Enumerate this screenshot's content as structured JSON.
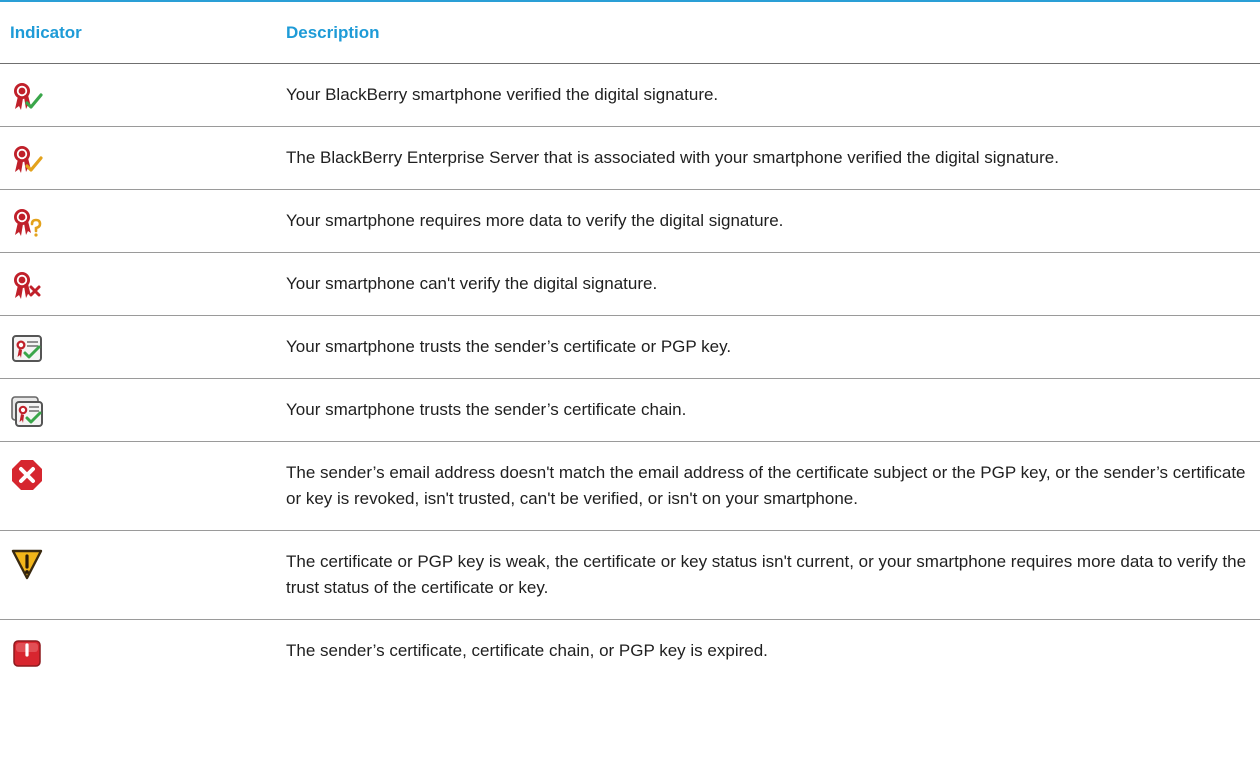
{
  "table": {
    "headers": {
      "indicator": "Indicator",
      "description": "Description"
    },
    "rows": [
      {
        "icon": "seal-check-green-icon",
        "description": "Your BlackBerry smartphone verified the digital signature."
      },
      {
        "icon": "seal-check-orange-icon",
        "description": "The BlackBerry Enterprise Server that is associated with your smartphone verified the digital signature."
      },
      {
        "icon": "seal-question-icon",
        "description": "Your smartphone requires more data to verify the digital signature."
      },
      {
        "icon": "seal-x-icon",
        "description": "Your smartphone can't verify the digital signature."
      },
      {
        "icon": "certificate-trusted-icon",
        "description": "Your smartphone trusts the sender’s certificate or PGP key."
      },
      {
        "icon": "certificate-chain-trusted-icon",
        "description": "Your smartphone trusts the sender’s certificate chain."
      },
      {
        "icon": "red-x-octagon-icon",
        "description": "The sender’s email address doesn't match the email address of the certificate subject or the PGP key, or the sender’s certificate or key is revoked, isn't trusted, can't be verified, or isn't on your smartphone."
      },
      {
        "icon": "yellow-warning-icon",
        "description": "The certificate or PGP key is weak, the certificate or key status isn't current, or your smartphone requires more data to verify the trust status of the certificate or key."
      },
      {
        "icon": "expired-red-icon",
        "description": "The sender’s certificate, certificate chain, or PGP key is expired."
      }
    ]
  },
  "colors": {
    "header_text": "#1e9bd7",
    "top_rule": "#2a9fd6",
    "seal_red": "#c0202a",
    "check_green": "#3aa64a",
    "check_orange": "#e3a21c",
    "warning_yellow": "#f2b51a"
  }
}
